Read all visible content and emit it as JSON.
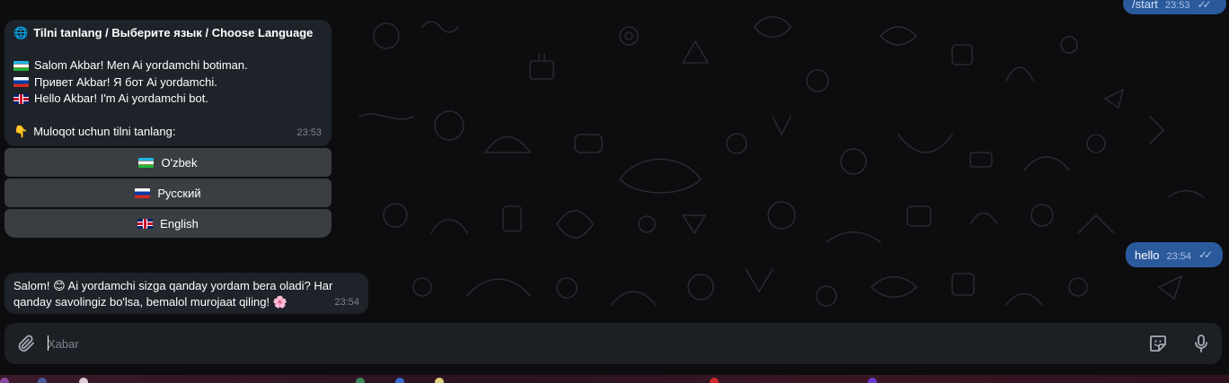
{
  "messages": {
    "start": {
      "text": "/start",
      "time": "23:53"
    },
    "language": {
      "title": "Tilni tanlang / Выберите язык / Choose Language",
      "line_uz": "Salom Akbar! Men Ai yordamchi botiman.",
      "line_ru": "Привет Akbar! Я бот Ai yordamchi.",
      "line_en": "Hello Akbar! I'm Ai yordamchi bot.",
      "prompt": "Muloqot uchun tilni tanlang:",
      "time": "23:53"
    },
    "hello": {
      "text": "hello",
      "time": "23:54"
    },
    "salom": {
      "line1": "Salom! 😊 Ai yordamchi sizga qanday yordam bera oladi? Har",
      "line2": "qanday savolingiz bo'lsa, bemalol murojaat qiling! 🌸",
      "time": "23:54"
    }
  },
  "keyboard": {
    "buttons": [
      {
        "label": "O'zbek",
        "flag": "flag-uzbekistan"
      },
      {
        "label": "Русский",
        "flag": "flag-russia"
      },
      {
        "label": "English",
        "flag": "flag-uk"
      }
    ]
  },
  "composer": {
    "placeholder": "Xabar"
  },
  "icons": {
    "globe": "🌐",
    "point_down": "👇",
    "attach": "paperclip-icon",
    "sticker": "sticker-icon",
    "mic": "microphone-icon",
    "read": "double-check-icon"
  },
  "colors": {
    "background": "#0d0d0f",
    "incoming_bubble": "#1e2229",
    "outgoing_bubble": "#2b5a9c",
    "keyboard_button": "#3e4248",
    "composer": "#1c1f24"
  }
}
